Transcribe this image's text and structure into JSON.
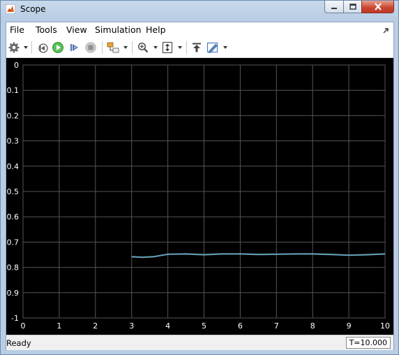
{
  "window": {
    "title": "Scope"
  },
  "menu": [
    "File",
    "Tools",
    "View",
    "Simulation",
    "Help"
  ],
  "toolbar": {
    "buttons": [
      "settings-icon",
      "step-back-icon",
      "run-icon",
      "step-forward-icon",
      "stop-icon",
      "signal-selector-icon",
      "zoom-icon",
      "autoscale-icon",
      "highlight-block-icon",
      "style-icon"
    ]
  },
  "status": {
    "text": "Ready",
    "time": "T=10.000"
  },
  "colors": {
    "plot_bg": "#000000",
    "grid": "#555555",
    "tick_text": "#ffffff",
    "trace": "#5aa7e6",
    "trace_highlight": "#c8f0a0"
  },
  "chart_data": {
    "type": "line",
    "title": "",
    "xlabel": "",
    "ylabel": "",
    "xlim": [
      0,
      10
    ],
    "ylim": [
      -1,
      0
    ],
    "xticks": [
      "0",
      "1",
      "2",
      "3",
      "4",
      "5",
      "6",
      "7",
      "8",
      "9",
      "10"
    ],
    "yticks": [
      "0",
      "-0.1",
      "-0.2",
      "-0.3",
      "-0.4",
      "-0.5",
      "-0.6",
      "-0.7",
      "-0.8",
      "-0.9",
      "-1"
    ],
    "grid": true,
    "series": [
      {
        "x": [
          3.0,
          3.3,
          3.6,
          4.0,
          4.5,
          5.0,
          5.5,
          6.0,
          6.5,
          7.0,
          7.5,
          8.0,
          8.5,
          9.0,
          9.5,
          10.0
        ],
        "values": [
          -0.758,
          -0.76,
          -0.758,
          -0.748,
          -0.747,
          -0.75,
          -0.747,
          -0.747,
          -0.749,
          -0.748,
          -0.747,
          -0.747,
          -0.749,
          -0.752,
          -0.75,
          -0.747
        ]
      }
    ]
  }
}
